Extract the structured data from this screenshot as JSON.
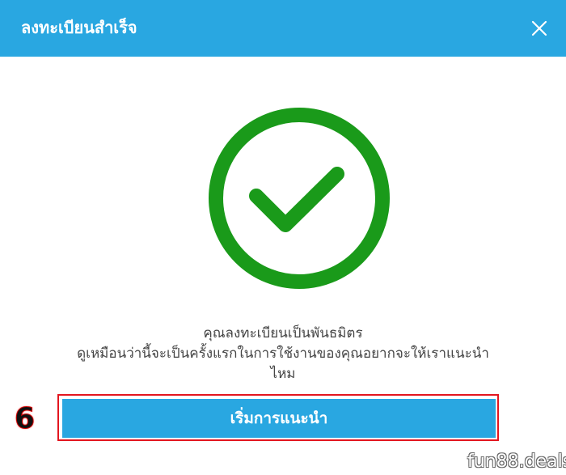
{
  "dialog": {
    "title": "ลงทะเบียนสำเร็จ",
    "close_icon": "close-icon"
  },
  "status_icon": {
    "name": "check-circle-icon",
    "color": "#1a9a1a"
  },
  "message": {
    "line1": "คุณลงทะเบียนเป็นพันธมิตร",
    "line2": "ดูเหมือนว่านี้จะเป็นครั้งแรกในการใช้งานของคุณอยากจะให้เราแนะนำ",
    "line3": "ไหม"
  },
  "annotation": {
    "step": "6",
    "highlight_color": "#e3161f"
  },
  "actions": {
    "start_tour_label": "เริ่มการแนะนำ"
  },
  "watermark": "fun88.deals",
  "colors": {
    "primary": "#29a7e1",
    "text": "#444444"
  }
}
